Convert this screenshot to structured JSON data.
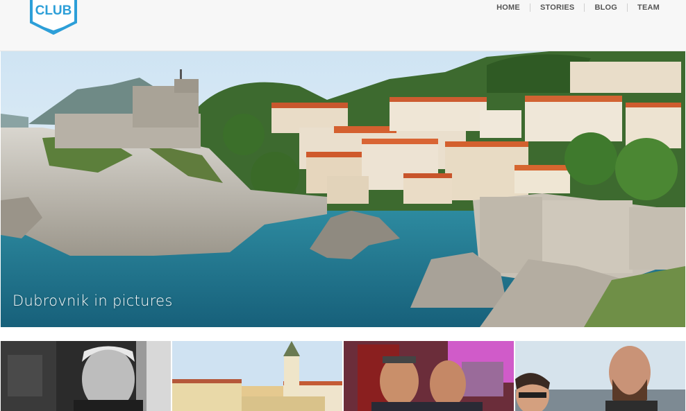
{
  "site": {
    "logo_text": "CLUB",
    "brand_color": "#2d9fd8"
  },
  "nav": {
    "items": [
      {
        "label": "HOME"
      },
      {
        "label": "STORIES"
      },
      {
        "label": "BLOG"
      },
      {
        "label": "TEAM"
      }
    ]
  },
  "hero": {
    "caption": "Dubrovnik in pictures"
  },
  "thumbnails": [
    {
      "subject": "man-portrait-grayscale"
    },
    {
      "subject": "city-square-tower"
    },
    {
      "subject": "two-men-neon-bar"
    },
    {
      "subject": "couple-outdoor-crowd"
    }
  ]
}
